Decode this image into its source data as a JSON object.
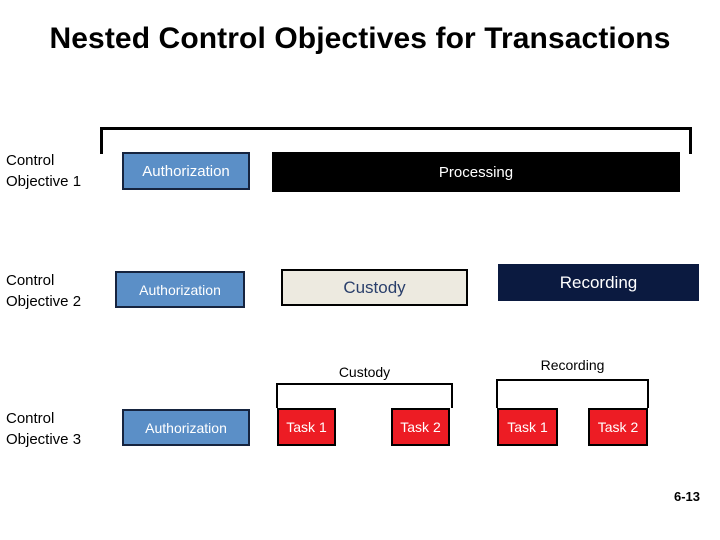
{
  "slide": {
    "title": "Nested Control Objectives for Transactions",
    "page_number": "6-13",
    "background_color": "#ffffff"
  },
  "colors": {
    "authorization_fill": "#5b8fc7",
    "authorization_border": "#16243f",
    "processing_fill": "#000000",
    "custody_fill": "#edeae0",
    "custody_text": "#2a3f6b",
    "recording_fill": "#0b1a40",
    "task_fill": "#ed1c24",
    "task_border": "#000000",
    "bracket_line": "#000000",
    "text_light": "#ffffff",
    "text_dark": "#000000"
  },
  "rows": [
    {
      "id": "control-objective-1",
      "label": "Control\nObjective 1",
      "bracket": {
        "present": true,
        "caption": ""
      },
      "boxes": [
        {
          "id": "r1-auth",
          "label": "Authorization",
          "style": "authorization"
        },
        {
          "id": "r1-processing",
          "label": "Processing",
          "style": "processing"
        }
      ]
    },
    {
      "id": "control-objective-2",
      "label": "Control\nObjective 2",
      "bracket": {
        "present": false,
        "caption": ""
      },
      "boxes": [
        {
          "id": "r2-auth",
          "label": "Authorization",
          "style": "authorization"
        },
        {
          "id": "r2-custody",
          "label": "Custody",
          "style": "custody"
        },
        {
          "id": "r2-recording",
          "label": "Recording",
          "style": "recording"
        }
      ]
    },
    {
      "id": "control-objective-3",
      "label": "Control\nObjective 3",
      "bracket": {
        "present": false,
        "caption": ""
      },
      "group_captions": [
        {
          "id": "caption-custody",
          "label": "Custody"
        },
        {
          "id": "caption-recording",
          "label": "Recording"
        }
      ],
      "boxes": [
        {
          "id": "r3-auth",
          "label": "Authorization",
          "style": "authorization"
        },
        {
          "id": "r3-task-c1",
          "label": "Task 1",
          "style": "task"
        },
        {
          "id": "r3-task-c2",
          "label": "Task 2",
          "style": "task"
        },
        {
          "id": "r3-task-r1",
          "label": "Task 1",
          "style": "task"
        },
        {
          "id": "r3-task-r2",
          "label": "Task 2",
          "style": "task"
        }
      ]
    }
  ]
}
